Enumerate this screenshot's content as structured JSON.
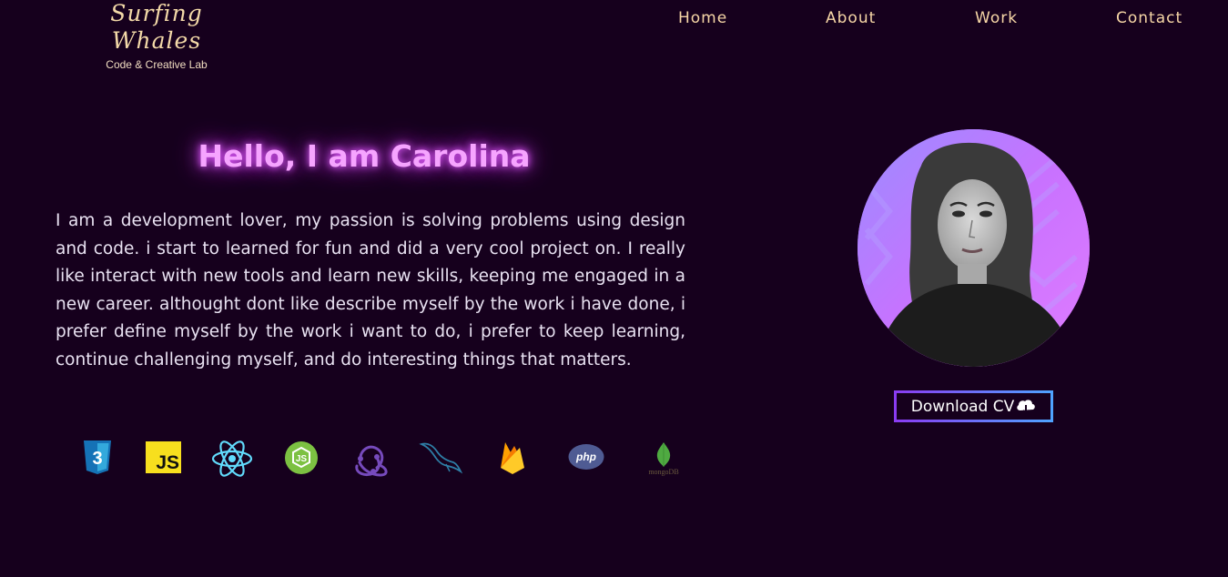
{
  "brand": {
    "title": "Surfing Whales",
    "subtitle": "Code & Creative Lab"
  },
  "nav": {
    "items": [
      {
        "label": "Home"
      },
      {
        "label": "About"
      },
      {
        "label": "Work"
      },
      {
        "label": "Contact"
      }
    ]
  },
  "hero": {
    "title": "Hello, I am Carolina",
    "text": "I am a development lover, my passion is solving problems using design and code. i start to learned for fun and did a very cool project on. I really like interact with new tools and learn new skills, keeping me engaged in a new career. althought dont like describe myself by the work i have done, i prefer define myself by the work i want to do, i prefer to keep learning, continue challenging myself, and do interesting things that matters."
  },
  "tech_icons": [
    {
      "name": "css3-icon",
      "label": "3"
    },
    {
      "name": "javascript-icon",
      "label": "JS"
    },
    {
      "name": "react-icon"
    },
    {
      "name": "nodejs-icon"
    },
    {
      "name": "redux-icon"
    },
    {
      "name": "mysql-icon"
    },
    {
      "name": "firebase-icon"
    },
    {
      "name": "php-icon",
      "label": "php"
    },
    {
      "name": "mongodb-icon",
      "label": "mongoDB"
    }
  ],
  "profile": {
    "photo_icon": "profile-photo",
    "cv_button_label": "Download CV",
    "cv_button_icon": "cloud-download-icon"
  },
  "colors": {
    "background": "#16001d",
    "nav_text": "#f6d6a6",
    "title_glow": "#f6a4ff",
    "body_text": "#e9e2f2",
    "button_border_start": "#8a3cf2",
    "button_border_end": "#4fa3ff"
  }
}
